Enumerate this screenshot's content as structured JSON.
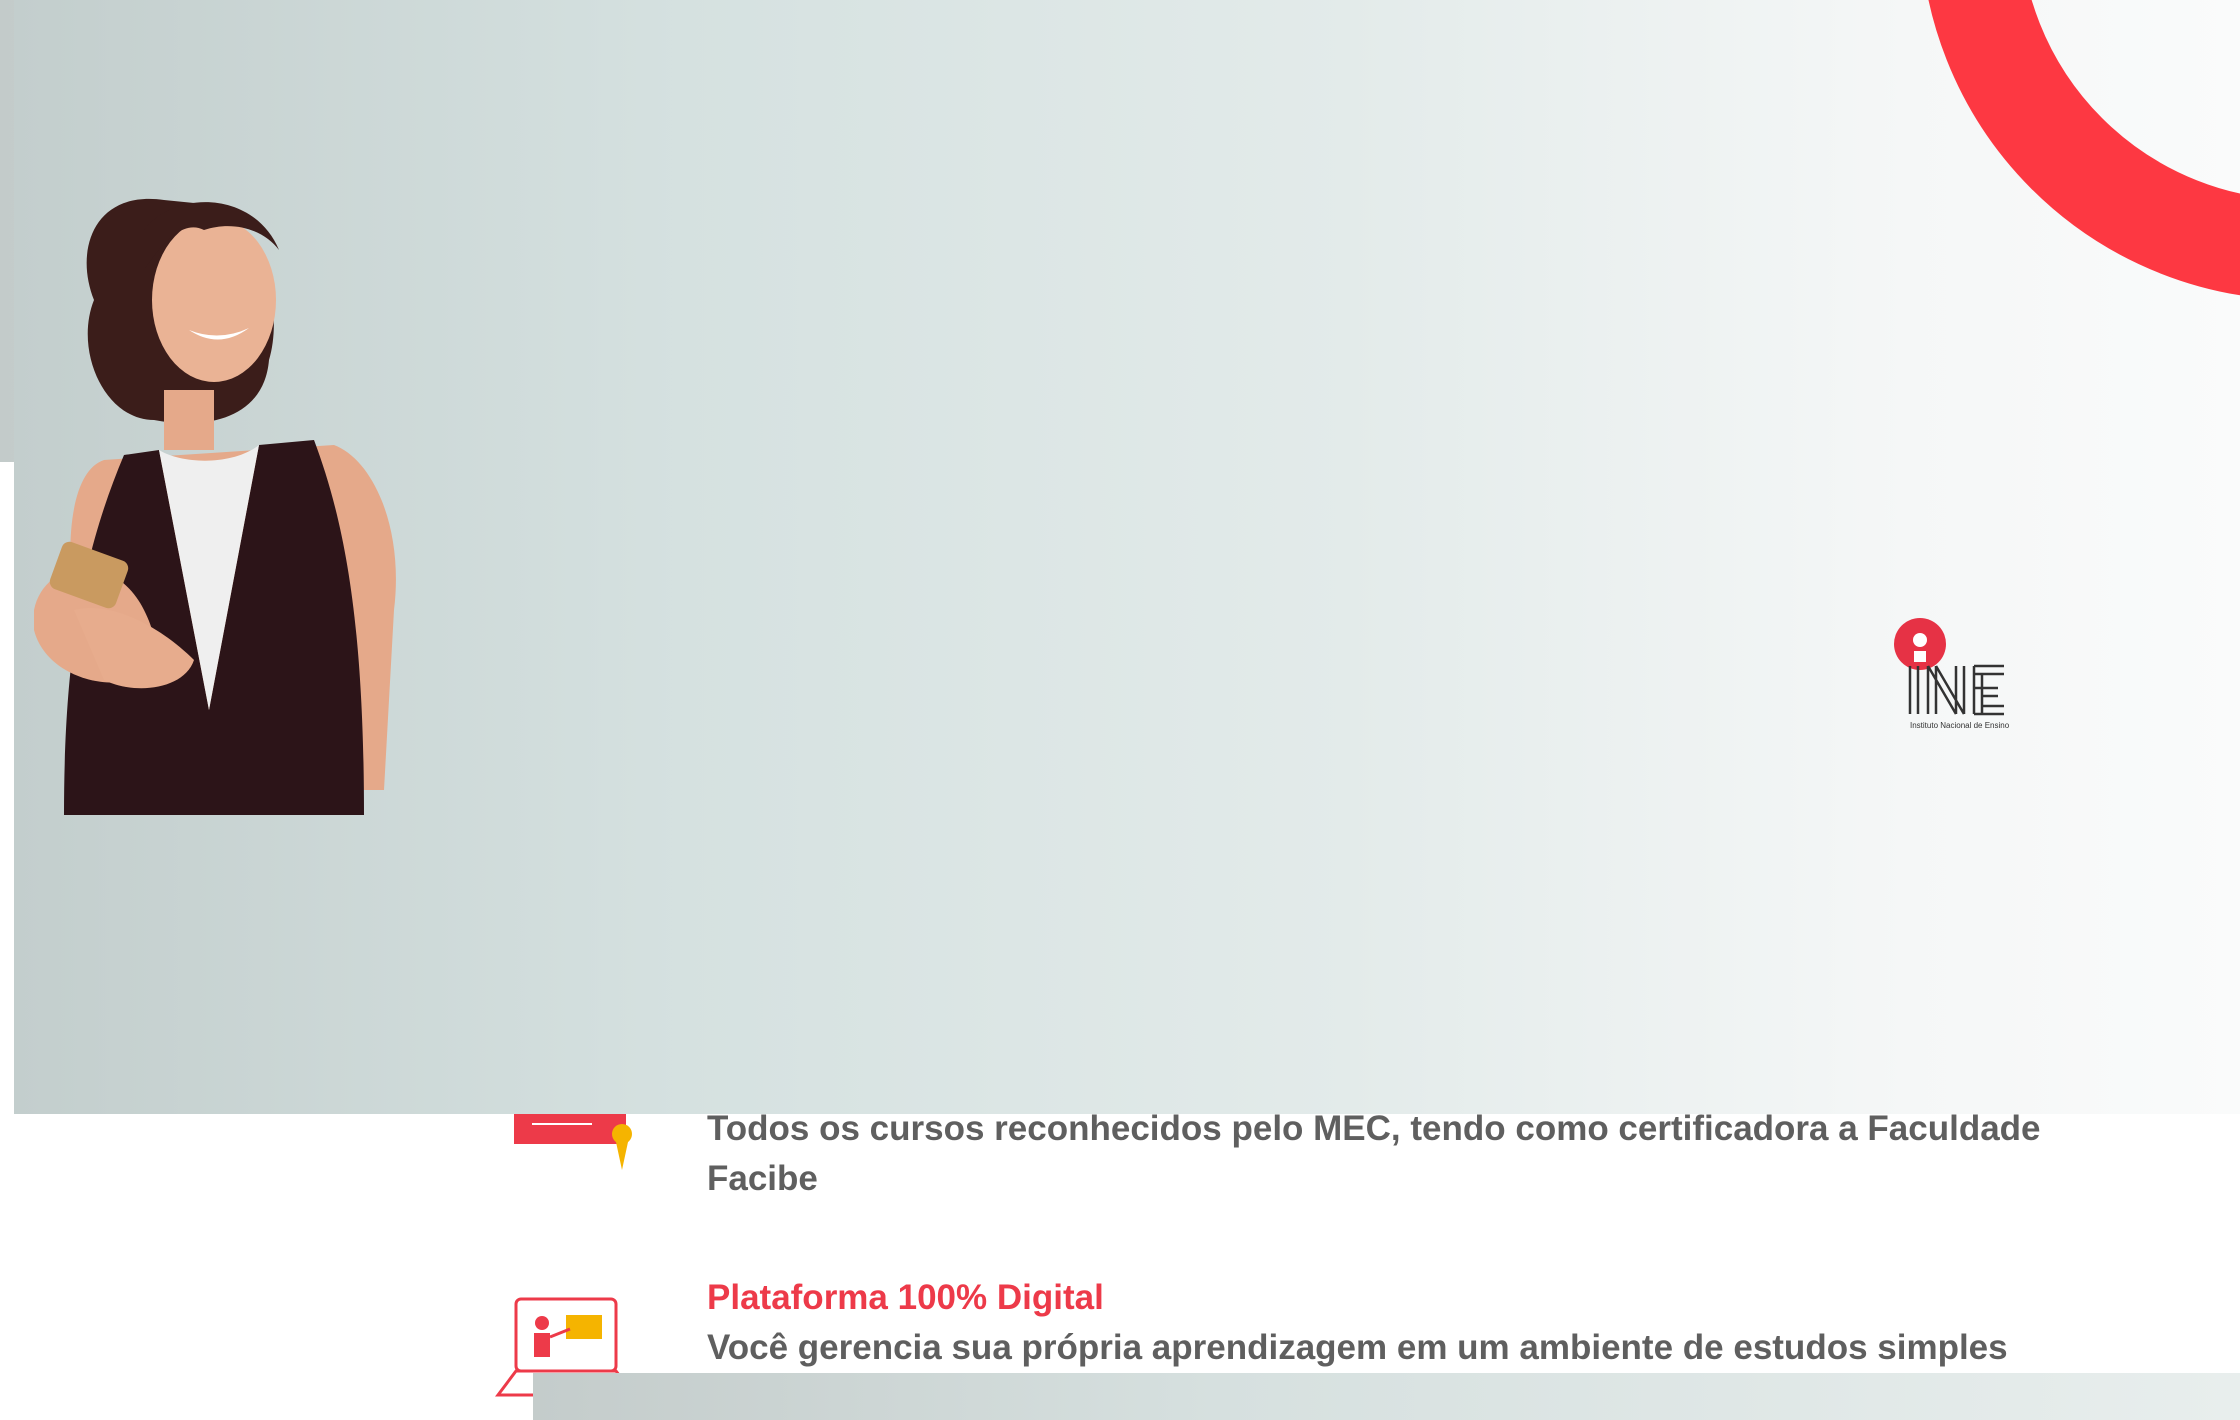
{
  "hero": {
    "logo_text": "INE",
    "logo_subtitle": "Instituto Nacional de Ensino",
    "accent_color": "#fd3842"
  },
  "features": [
    {
      "icon": "certificate-icon",
      "title": "",
      "description": "Todos os cursos reconhecidos pelo MEC, tendo como certificadora a Faculdade Facibe"
    },
    {
      "icon": "laptop-teacher-icon",
      "title": "Plataforma 100% Digital",
      "description": "Você gerencia sua própria aprendizagem em um ambiente de estudos simples"
    }
  ],
  "colors": {
    "title_red": "#ed3a49",
    "body_gray": "#5f5f5f"
  }
}
